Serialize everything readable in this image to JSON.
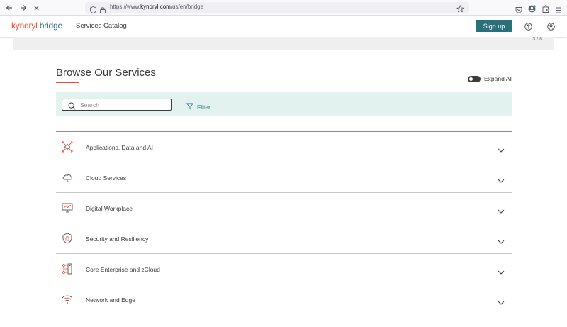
{
  "browser": {
    "url_prefix": "https://www.",
    "url_domain": "kyndryl.com",
    "url_path": "/us/en/bridge"
  },
  "header": {
    "brand_part1": "kyndryl",
    "brand_part2": "bridge",
    "section_title": "Services Catalog",
    "signup_label": "Sign up"
  },
  "carousel": {
    "counter": "3 / 6"
  },
  "main": {
    "title": "Browse Our Services",
    "expand_all_label": "Expand All",
    "search_placeholder": "Search",
    "filter_label": "Filter",
    "categories": [
      {
        "label": "Applications, Data and AI",
        "icon": "ai-network-icon"
      },
      {
        "label": "Cloud Services",
        "icon": "cloud-icon"
      },
      {
        "label": "Digital Workplace",
        "icon": "monitor-icon"
      },
      {
        "label": "Security and Resiliency",
        "icon": "shield-lock-icon"
      },
      {
        "label": "Core Enterprise and zCloud",
        "icon": "server-icon"
      },
      {
        "label": "Network and Edge",
        "icon": "wifi-icon"
      }
    ]
  },
  "colors": {
    "brand_red": "#ff462d",
    "brand_teal": "#29707a",
    "filter_bg": "#e2f2ee",
    "text": "#3d3c3c"
  }
}
